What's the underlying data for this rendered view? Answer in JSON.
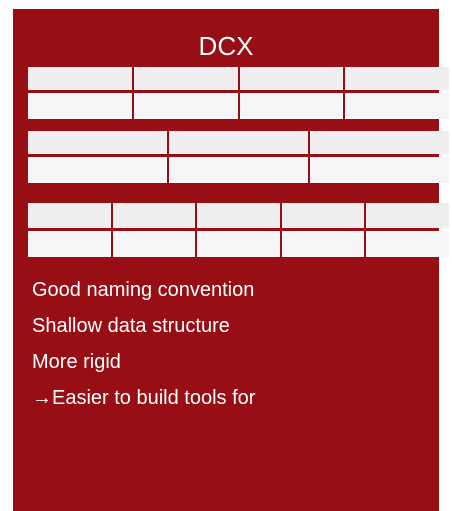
{
  "card": {
    "title": "DCX",
    "background": "#970e14"
  },
  "tables": [
    {
      "columns": 4,
      "rows": 2
    },
    {
      "columns": 3,
      "rows": 2
    },
    {
      "columns": 5,
      "rows": 2
    }
  ],
  "bullets": [
    "Good naming convention",
    "Shallow data structure",
    "More rigid",
    "→Easier to build tools for"
  ]
}
